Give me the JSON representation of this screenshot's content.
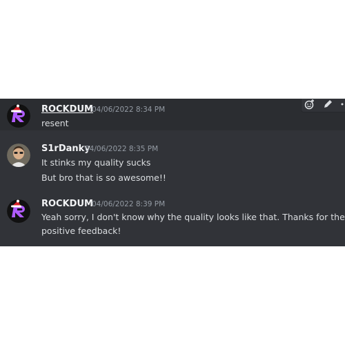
{
  "messages": [
    {
      "author": "ROCKDUM",
      "timestamp": "04/06/2022 8:34 PM",
      "lines": [
        "resent"
      ]
    },
    {
      "author": "S1rDanky",
      "timestamp": "04/06/2022 8:35 PM",
      "lines": [
        "It stinks my quality sucks",
        "But bro that is so awesome!!"
      ]
    },
    {
      "author": "ROCKDUM",
      "timestamp": "04/06/2022 8:39 PM",
      "lines": [
        "Yeah sorry, I don't know why the quality looks like that. Thanks for the",
        "positive feedback!"
      ]
    }
  ],
  "toolbar": {
    "icons": [
      "add-reaction-icon",
      "edit-icon",
      "more-icon"
    ]
  },
  "colors": {
    "background": "#313338",
    "hover_background": "#2b2d31",
    "username": "#f2f3f5",
    "timestamp": "#949ba4",
    "message_text": "#dbdee1",
    "avatar_accent": "#b05cff"
  }
}
